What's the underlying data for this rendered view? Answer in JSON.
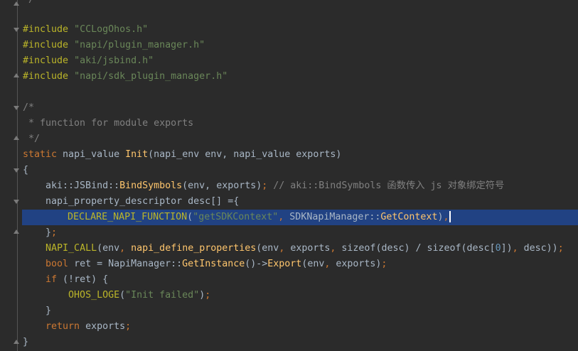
{
  "colors": {
    "background": "#2b2b2b",
    "keyword": "#cc7832",
    "string": "#6a8759",
    "comment": "#808080",
    "function": "#ffc66d",
    "macro": "#bbb529",
    "number": "#6897bb",
    "text": "#a9b7c6",
    "selection": "#214283"
  },
  "code": {
    "l0": "*/",
    "l2a": "#include",
    "l2b": " ",
    "l2c": "\"CCLogOhos.h\"",
    "l3a": "#include",
    "l3c": "\"napi/plugin_manager.h\"",
    "l4a": "#include",
    "l4c": "\"aki/jsbind.h\"",
    "l5a": "#include",
    "l5c": "\"napi/sdk_plugin_manager.h\"",
    "l7": "/*",
    "l8": " * function for module exports",
    "l9": " */",
    "l10a": "static",
    "l10b": " napi_value ",
    "l10c": "Init",
    "l10d": "(napi_env env, napi_value exports)",
    "l11": "{",
    "l12a": "    aki::JSBind::",
    "l12b": "BindSymbols",
    "l12c": "(env, exports)",
    "l12d": ";",
    "l12e": " // aki::BindSymbols 函数传入 js 对象绑定符号",
    "l13": "    napi_property_descriptor desc[] ={",
    "l14a": "        ",
    "l14b": "DECLARE_NAPI_FUNCTION",
    "l14c": "(",
    "l14d": "\"getSDKContext\"",
    "l14e": ",",
    "l14f": " SDKNapiManager::",
    "l14g": "GetContext",
    "l14h": ")",
    "l14i": ",",
    "l15a": "    }",
    "l15b": ";",
    "l16a": "    ",
    "l16b": "NAPI_CALL",
    "l16c": "(env",
    "l16d": ",",
    "l16e": " ",
    "l16f": "napi_define_properties",
    "l16g": "(env",
    "l16h": ",",
    "l16i": " exports",
    "l16j": ",",
    "l16k": " sizeof",
    "l16l": "(desc) / ",
    "l16m": "sizeof",
    "l16n": "(desc[",
    "l16o": "0",
    "l16p": "])",
    "l16q": ",",
    "l16r": " desc))",
    "l16s": ";",
    "l17a": "    ",
    "l17b": "bool",
    "l17c": " ret = NapiManager::",
    "l17d": "GetInstance",
    "l17e": "()->",
    "l17f": "Export",
    "l17g": "(env",
    "l17h": ",",
    "l17i": " exports)",
    "l17j": ";",
    "l18a": "    ",
    "l18b": "if",
    "l18c": " (!ret) {",
    "l19a": "        ",
    "l19b": "OHOS_LOGE",
    "l19c": "(",
    "l19d": "\"Init failed\"",
    "l19e": ")",
    "l19f": ";",
    "l20": "    }",
    "l21a": "    ",
    "l21b": "return",
    "l21c": " exports",
    "l21d": ";",
    "l22": "}"
  }
}
